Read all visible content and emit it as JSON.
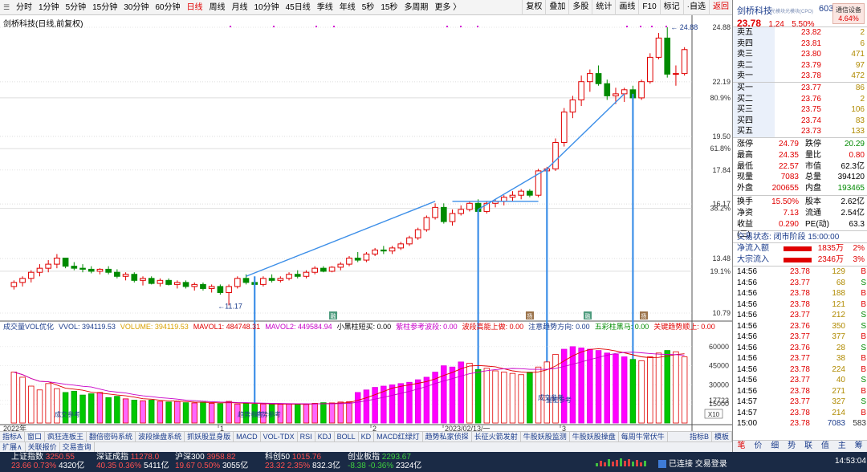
{
  "toolbar": {
    "periods": [
      "分时",
      "1分钟",
      "5分钟",
      "15分钟",
      "30分钟",
      "60分钟",
      "日线",
      "周线",
      "月线",
      "10分钟",
      "45日线",
      "季线",
      "年线",
      "5秒",
      "15秒",
      "多周期",
      "更多 〉"
    ],
    "active_period": "日线",
    "right_buttons": [
      "复权",
      "叠加",
      "多股",
      "统计",
      "画线",
      "F10",
      "标记",
      "·自选",
      "返回"
    ]
  },
  "chart": {
    "title": "剑桥科技(日线,前复权)",
    "price_labels": [
      "24.88",
      "22.19",
      "80.9%",
      "19.50",
      "61.8%",
      "17.84",
      "16.17",
      "38.2%",
      "13.48",
      "19.1%",
      "10.79"
    ],
    "high_mark": "24.88",
    "low_mark": "11.17",
    "year_label": "2022年",
    "month_labels": [
      "1",
      "2",
      "2023/02/13/一",
      "3"
    ],
    "event_markers": [
      "融",
      "扬",
      "融",
      "扬"
    ],
    "volume_indicator": {
      "name": "成交量VOL优化",
      "items": [
        {
          "label": "VVOL: 394119.53",
          "color": "#1c3d8c"
        },
        {
          "label": "VOLUME: 394119.53",
          "color": "#d9a000"
        },
        {
          "label": "MAVOL1: 484748.31",
          "color": "#e00000"
        },
        {
          "label": "MAVOL2: 449584.94",
          "color": "#c800c8"
        },
        {
          "label": "小黑柱短买: 0.00",
          "color": "#000000"
        },
        {
          "label": "紫柱参考波段: 0.00",
          "color": "#c800c8"
        },
        {
          "label": "波段高能上做: 0.00",
          "color": "#e00000"
        },
        {
          "label": "注意趋势方向: 0.00",
          "color": "#1c3d8c"
        },
        {
          "label": "五彩柱黑马: 0.00",
          "color": "#008a00"
        },
        {
          "label": "关键趋势顺上: 0.00",
          "color": "#e00000"
        }
      ],
      "volume_labels": [
        "60000",
        "45000",
        "30000",
        "17723",
        "15000",
        "X10"
      ],
      "annotations": [
        "成交参考",
        "趋势参考",
        "趋势参考",
        "成交参考",
        "量能参考"
      ]
    },
    "chart_data": {
      "type": "candlestick",
      "title": "剑桥科技(日线,前复权)",
      "ylim": [
        10.79,
        24.88
      ],
      "series": [
        {
          "name": "K线",
          "ohlc": [
            [
              12.1,
              12.4,
              11.95,
              12.3
            ],
            [
              12.3,
              12.6,
              12.1,
              12.5
            ],
            [
              12.5,
              12.9,
              12.3,
              12.8
            ],
            [
              12.8,
              13.2,
              12.6,
              13.0
            ],
            [
              13.0,
              13.4,
              12.8,
              13.2
            ],
            [
              13.2,
              13.7,
              13.0,
              13.5
            ],
            [
              13.5,
              13.5,
              13.0,
              13.1
            ],
            [
              13.1,
              13.3,
              12.9,
              13.0
            ],
            [
              13.0,
              13.2,
              12.8,
              12.95
            ],
            [
              12.95,
              13.1,
              12.75,
              12.85
            ],
            [
              12.85,
              13.0,
              12.7,
              12.95
            ],
            [
              12.95,
              13.1,
              12.7,
              12.8
            ],
            [
              12.8,
              12.95,
              12.5,
              12.6
            ],
            [
              12.6,
              12.8,
              12.4,
              12.7
            ],
            [
              12.7,
              12.8,
              12.3,
              12.4
            ],
            [
              12.4,
              12.6,
              12.15,
              12.5
            ],
            [
              12.5,
              12.6,
              12.2,
              12.25
            ],
            [
              12.25,
              12.5,
              12.1,
              12.4
            ],
            [
              12.4,
              12.5,
              12.15,
              12.2
            ],
            [
              12.2,
              12.4,
              12.0,
              12.3
            ],
            [
              12.3,
              12.4,
              12.0,
              12.1
            ],
            [
              12.1,
              12.3,
              11.9,
              12.2
            ],
            [
              12.2,
              12.3,
              11.9,
              12.0
            ],
            [
              12.0,
              12.2,
              11.8,
              12.1
            ],
            [
              12.1,
              12.2,
              11.7,
              11.8
            ],
            [
              11.8,
              12.2,
              11.17,
              12.1
            ],
            [
              12.1,
              12.6,
              12.0,
              12.5
            ],
            [
              12.5,
              12.7,
              12.2,
              12.3
            ],
            [
              12.3,
              12.5,
              12.1,
              12.2
            ],
            [
              12.2,
              12.6,
              12.1,
              12.5
            ],
            [
              12.5,
              12.7,
              12.3,
              12.4
            ],
            [
              12.4,
              12.6,
              12.3,
              12.5
            ],
            [
              12.5,
              12.8,
              12.4,
              12.7
            ],
            [
              12.7,
              12.9,
              12.5,
              12.6
            ],
            [
              12.6,
              12.9,
              12.5,
              12.8
            ],
            [
              12.8,
              13.1,
              12.7,
              13.0
            ],
            [
              13.0,
              13.1,
              12.8,
              12.85
            ],
            [
              12.85,
              13.1,
              12.8,
              13.05
            ],
            [
              13.05,
              13.3,
              12.9,
              13.2
            ],
            [
              13.2,
              13.6,
              13.1,
              13.5
            ],
            [
              13.5,
              13.8,
              13.3,
              13.4
            ],
            [
              13.4,
              13.8,
              13.3,
              13.7
            ],
            [
              13.7,
              14.0,
              13.6,
              13.9
            ],
            [
              13.9,
              14.1,
              13.7,
              13.85
            ],
            [
              13.85,
              14.1,
              13.7,
              14.0
            ],
            [
              14.0,
              14.3,
              13.9,
              14.2
            ],
            [
              14.2,
              14.6,
              14.1,
              14.5
            ],
            [
              14.5,
              15.0,
              14.4,
              14.9
            ],
            [
              14.9,
              15.6,
              14.8,
              15.5
            ],
            [
              15.5,
              16.2,
              15.4,
              16.0
            ],
            [
              16.0,
              16.2,
              15.2,
              15.3
            ],
            [
              15.3,
              15.9,
              15.1,
              15.7
            ],
            [
              15.7,
              16.1,
              15.6,
              15.9
            ],
            [
              15.9,
              16.3,
              15.8,
              16.2
            ],
            [
              16.2,
              16.4,
              15.7,
              15.8
            ],
            [
              15.8,
              16.3,
              15.7,
              16.2
            ],
            [
              16.2,
              16.4,
              16.0,
              16.3
            ],
            [
              16.3,
              16.6,
              16.1,
              16.5
            ],
            [
              16.5,
              16.8,
              16.3,
              16.6
            ],
            [
              16.6,
              16.9,
              16.4,
              16.8
            ],
            [
              16.8,
              16.9,
              16.5,
              16.6
            ],
            [
              16.6,
              17.9,
              16.5,
              17.8
            ],
            [
              17.8,
              18.0,
              17.5,
              17.9
            ],
            [
              17.9,
              19.4,
              17.8,
              19.2
            ],
            [
              19.2,
              20.9,
              19.0,
              20.7
            ],
            [
              20.7,
              21.5,
              20.4,
              21.3
            ],
            [
              21.3,
              22.5,
              21.0,
              22.2
            ],
            [
              22.2,
              22.8,
              21.7,
              22.6
            ],
            [
              22.6,
              23.0,
              22.0,
              22.1
            ],
            [
              22.1,
              22.3,
              21.3,
              21.5
            ],
            [
              21.5,
              21.9,
              21.1,
              21.6
            ],
            [
              21.6,
              21.9,
              21.2,
              21.8
            ],
            [
              21.8,
              22.0,
              21.0,
              21.4
            ],
            [
              21.4,
              22.3,
              21.3,
              22.2
            ],
            [
              22.2,
              23.6,
              22.1,
              23.4
            ],
            [
              23.4,
              24.6,
              23.3,
              24.35
            ],
            [
              24.35,
              24.88,
              22.4,
              22.57
            ],
            [
              22.57,
              23.0,
              22.0,
              22.6
            ],
            [
              22.6,
              23.9,
              22.5,
              23.78
            ]
          ]
        },
        {
          "name": "VOLUME",
          "values": [
            40000,
            36000,
            29000,
            26000,
            31000,
            27000,
            24000,
            25000,
            22000,
            23000,
            24000,
            20000,
            21000,
            19000,
            18000,
            17500,
            18000,
            17000,
            16500,
            17000,
            16000,
            15800,
            16500,
            15500,
            15200,
            17000,
            15000,
            15500,
            14800,
            15000,
            14500,
            14800,
            15200,
            15000,
            14600,
            15500,
            16000,
            15800,
            16500,
            16800,
            24000,
            26000,
            28000,
            29000,
            30000,
            31000,
            32000,
            34000,
            36000,
            40000,
            45000,
            44000,
            48000,
            47000,
            42000,
            43000,
            41000,
            40000,
            39000,
            38000,
            40000,
            44000,
            48000,
            54000,
            58000,
            60000,
            59000,
            58000,
            57000,
            55000,
            54000,
            52000,
            50000,
            49000,
            52000,
            55000,
            57000,
            56000,
            52000
          ]
        }
      ]
    }
  },
  "tabs_row1": [
    "指标A",
    "窗口",
    "疯狂连板王",
    "翻倍密码系统",
    "波段操盘系统",
    "抓妖股显身版",
    "MACD",
    "VOL-TDX",
    "RSI",
    "KDJ",
    "BOLL",
    "KD",
    "MACD红绿灯",
    "趋势私家侦探",
    "长征火箭发射",
    "牛股妖股监测",
    "牛股妖股操盘",
    "每周牛常伏牛"
  ],
  "tabs_row1_right": [
    "指标B",
    "模板"
  ],
  "tabs_row2": [
    "扩展∧",
    "关联报价",
    "交易查询"
  ],
  "quote": {
    "name": "剑桥科技",
    "code": "603083",
    "sub": "光模块光模块(CPO)",
    "badge_title": "通信设备",
    "badge_pct": "4.64%",
    "price": "23.78",
    "change": "1.24",
    "pct": "5.50%",
    "sell": [
      {
        "label": "卖五",
        "price": "23.82",
        "vol": "2"
      },
      {
        "label": "卖四",
        "price": "23.81",
        "vol": "6"
      },
      {
        "label": "卖三",
        "price": "23.80",
        "vol": "471"
      },
      {
        "label": "卖二",
        "price": "23.79",
        "vol": "97"
      },
      {
        "label": "卖一",
        "price": "23.78",
        "vol": "472"
      }
    ],
    "buy": [
      {
        "label": "买一",
        "price": "23.77",
        "vol": "86"
      },
      {
        "label": "买二",
        "price": "23.76",
        "vol": "2"
      },
      {
        "label": "买三",
        "price": "23.75",
        "vol": "106"
      },
      {
        "label": "买四",
        "price": "23.74",
        "vol": "83"
      },
      {
        "label": "买五",
        "price": "23.73",
        "vol": "133"
      }
    ],
    "stats": [
      {
        "k": "涨停",
        "v": "24.79",
        "vc": "red",
        "k2": "跌停",
        "v2": "20.29",
        "v2c": "green"
      },
      {
        "k": "最高",
        "v": "24.35",
        "vc": "red",
        "k2": "量比",
        "v2": "0.80",
        "v2c": "red"
      },
      {
        "k": "最低",
        "v": "22.57",
        "vc": "red",
        "k2": "市值",
        "v2": "62.3亿",
        "v2c": "blk"
      },
      {
        "k": "现量",
        "v": "7083",
        "vc": "red",
        "k2": "总量",
        "v2": "394120",
        "v2c": "blk"
      },
      {
        "k": "外盘",
        "v": "200655",
        "vc": "red",
        "k2": "内盘",
        "v2": "193465",
        "v2c": "green"
      }
    ],
    "stats2": [
      {
        "k": "换手",
        "v": "15.50%",
        "vc": "red",
        "k2": "股本",
        "v2": "2.62亿",
        "v2c": "blk"
      },
      {
        "k": "净资",
        "v": "7.13",
        "vc": "red",
        "k2": "流通",
        "v2": "2.54亿",
        "v2c": "blk"
      },
      {
        "k": "收益(三)",
        "v": "0.290",
        "vc": "red",
        "k2": "PE(动)",
        "v2": "63.3",
        "v2c": "blk"
      }
    ],
    "trade_state": "交易状态: 闭市阶段 15:00:00",
    "flows": [
      {
        "k": "净流入额",
        "v": "1835万",
        "p": "2%"
      },
      {
        "k": "大宗流入",
        "v": "2346万",
        "p": "3%"
      }
    ],
    "ticks": [
      {
        "t": "14:56",
        "p": "23.78",
        "v": "129",
        "vc": "gold",
        "n": "B"
      },
      {
        "t": "14:56",
        "p": "23.77",
        "v": "68",
        "vc": "gold",
        "n": "S"
      },
      {
        "t": "14:56",
        "p": "23.78",
        "v": "188",
        "vc": "gold",
        "n": "B"
      },
      {
        "t": "14:56",
        "p": "23.78",
        "v": "121",
        "vc": "gold",
        "n": "B"
      },
      {
        "t": "14:56",
        "p": "23.77",
        "v": "212",
        "vc": "gold",
        "n": "S"
      },
      {
        "t": "14:56",
        "p": "23.76",
        "v": "350",
        "vc": "gold",
        "n": "S"
      },
      {
        "t": "14:56",
        "p": "23.77",
        "v": "377",
        "vc": "gold",
        "n": "B"
      },
      {
        "t": "14:56",
        "p": "23.76",
        "v": "28",
        "vc": "gold",
        "n": "S"
      },
      {
        "t": "14:56",
        "p": "23.77",
        "v": "38",
        "vc": "gold",
        "n": "B"
      },
      {
        "t": "14:56",
        "p": "23.78",
        "v": "224",
        "vc": "gold",
        "n": "B"
      },
      {
        "t": "14:56",
        "p": "23.77",
        "v": "40",
        "vc": "gold",
        "n": "S"
      },
      {
        "t": "14:56",
        "p": "23.78",
        "v": "271",
        "vc": "gold",
        "n": "B"
      },
      {
        "t": "14:57",
        "p": "23.77",
        "v": "327",
        "vc": "gold",
        "n": "S"
      },
      {
        "t": "14:57",
        "p": "23.78",
        "v": "214",
        "vc": "gold",
        "n": "B"
      },
      {
        "t": "15:00",
        "p": "23.78",
        "v": "7083",
        "vc": "blue",
        "n": "583"
      }
    ],
    "side_tabs": [
      "笔",
      "价",
      "细",
      "势",
      "联",
      "值",
      "主",
      "筹"
    ]
  },
  "status": {
    "indices": [
      {
        "name": "上证指数",
        "val": "3250.55",
        "chg": "23.66",
        "pct": "0.73%",
        "amt": "4320亿",
        "dir": "up"
      },
      {
        "name": "深证成指",
        "val": "11278.0",
        "chg": "40.35",
        "pct": "0.36%",
        "amt": "5411亿",
        "dir": "up"
      },
      {
        "name": "沪深300",
        "val": "3958.82",
        "chg": "19.67",
        "pct": "0.50%",
        "amt": "3055亿",
        "dir": "up"
      },
      {
        "name": "科创50",
        "val": "1015.76",
        "chg": "23.32",
        "pct": "2.35%",
        "amt": "832.3亿",
        "dir": "up"
      },
      {
        "name": "创业板指",
        "val": "2293.67",
        "chg": "-8.38",
        "pct": "-0.36%",
        "amt": "2324亿",
        "dir": "dn"
      }
    ],
    "connection": "已连接 交易登录",
    "time": "14:53:04"
  }
}
